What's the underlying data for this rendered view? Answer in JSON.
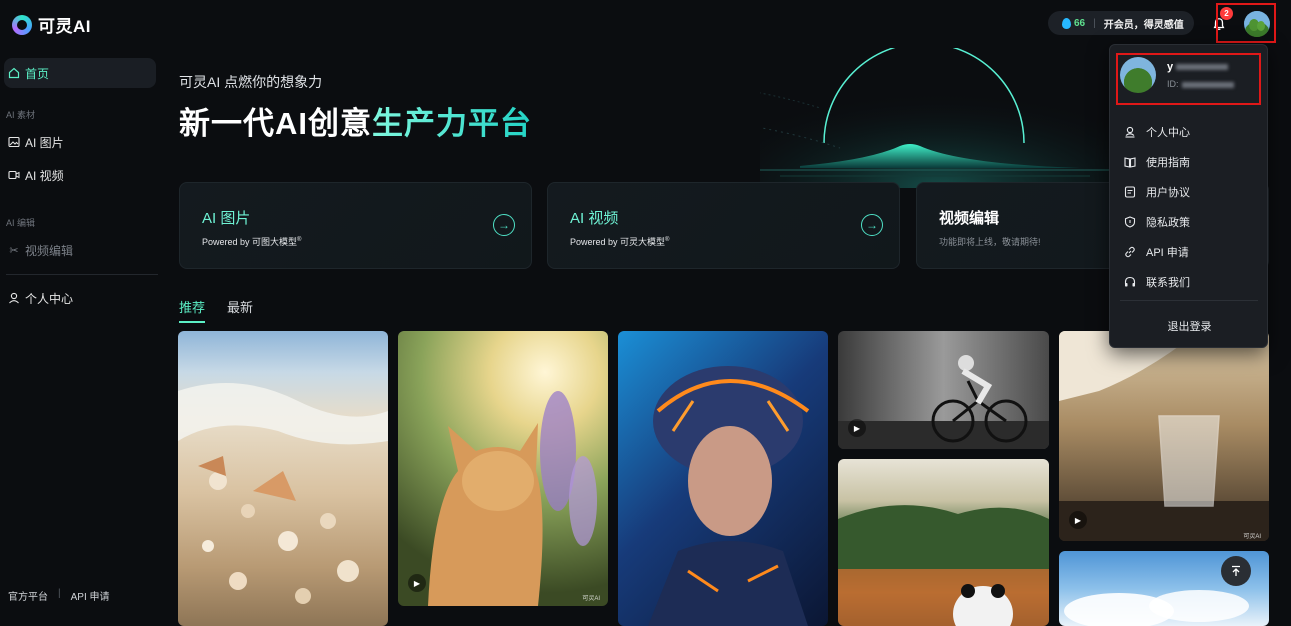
{
  "brand": {
    "name": "可灵AI"
  },
  "topbar": {
    "credits": "66",
    "vip_label": "开会员，得灵感值",
    "notification_count": "2"
  },
  "sidebar": {
    "home": "首页",
    "section_material": "AI 素材",
    "ai_image": "AI 图片",
    "ai_video": "AI 视频",
    "section_edit": "AI 编辑",
    "video_edit": "视频编辑",
    "personal_center": "个人中心",
    "footer_official": "官方平台",
    "footer_api": "API 申请"
  },
  "hero": {
    "subtitle": "可灵AI 点燃你的想象力",
    "title_main": "新一代AI创意",
    "title_accent": "生产力平台"
  },
  "cards": [
    {
      "title": "AI 图片",
      "subtitle": "Powered by 可图大模型",
      "mark": "®"
    },
    {
      "title": "AI 视频",
      "subtitle": "Powered by 可灵大模型",
      "mark": "®"
    },
    {
      "title": "视频编辑",
      "subtitle": "功能即将上线，敬请期待!"
    }
  ],
  "tabs": [
    {
      "label": "推荐",
      "active": true
    },
    {
      "label": "最新",
      "active": false
    }
  ],
  "gallery": {
    "watermark": "可灵AI"
  },
  "dropdown": {
    "user_name": "y",
    "user_id_label": "ID:",
    "items": [
      "个人中心",
      "使用指南",
      "用户协议",
      "隐私政策",
      "API 申请",
      "联系我们"
    ],
    "logout": "退出登录"
  },
  "colors": {
    "accent": "#5cf0c6",
    "background": "#0b0d10",
    "badge": "#ff3b3b",
    "highlight_box": "#e01818"
  }
}
